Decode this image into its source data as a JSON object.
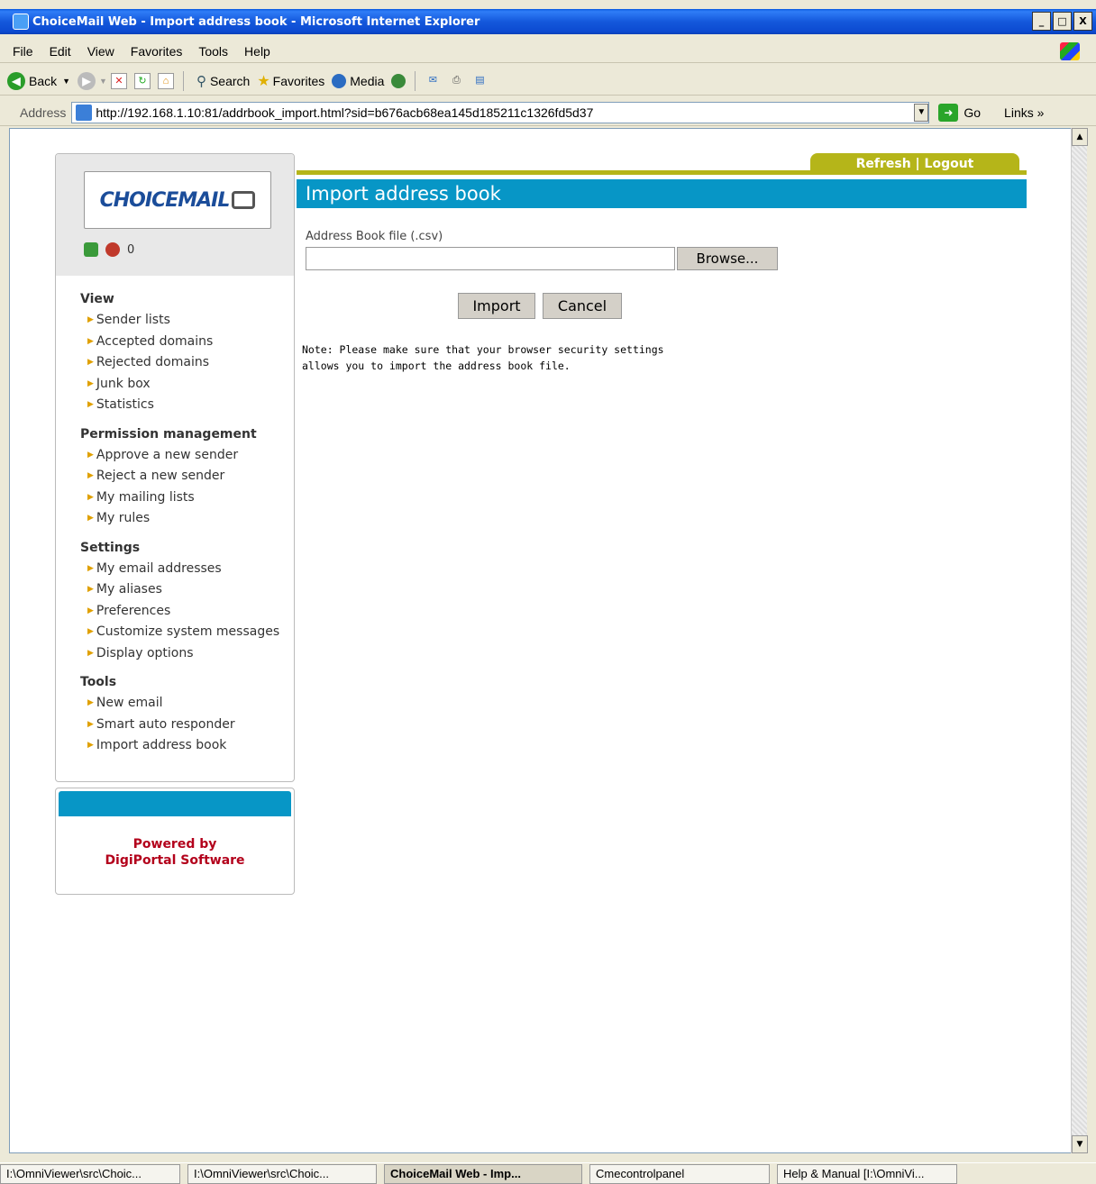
{
  "window": {
    "title": "ChoiceMail Web - Import address book - Microsoft Internet Explorer",
    "controls": [
      "_",
      "□",
      "X"
    ]
  },
  "menu": [
    "File",
    "Edit",
    "View",
    "Favorites",
    "Tools",
    "Help"
  ],
  "toolbar": {
    "back": "Back",
    "search": "Search",
    "favorites": "Favorites",
    "media": "Media"
  },
  "address": {
    "label": "Address",
    "url": "http://192.168.1.10:81/addrbook_import.html?sid=b676acb68ea145d185211c1326fd5d37",
    "go": "Go",
    "links": "Links"
  },
  "logo": {
    "text": "CHOICEMAIL",
    "count": "0"
  },
  "sidebar": {
    "groups": [
      {
        "heading": "View",
        "items": [
          "Sender lists",
          "Accepted domains",
          "Rejected domains",
          "Junk box",
          "Statistics"
        ]
      },
      {
        "heading": "Permission management",
        "items": [
          "Approve a new sender",
          "Reject a new sender",
          "My mailing lists",
          "My rules"
        ]
      },
      {
        "heading": "Settings",
        "items": [
          "My email addresses",
          "My aliases",
          "Preferences",
          "Customize system messages",
          "Display options"
        ]
      },
      {
        "heading": "Tools",
        "items": [
          "New email",
          "Smart auto responder",
          "Import address book"
        ]
      }
    ],
    "powered_line1": "Powered by",
    "powered_line2": "DigiPortal Software"
  },
  "header": {
    "links": "Refresh | Logout",
    "title": "Import address book"
  },
  "form": {
    "file_label": "Address Book file (.csv)",
    "file_value": "",
    "browse": "Browse...",
    "import": "Import",
    "cancel": "Cancel",
    "note_line1": "Note: Please make sure that your browser security settings",
    "note_line2": "allows you to import the address book file."
  },
  "taskbar": [
    "I:\\OmniViewer\\src\\Choic...",
    "I:\\OmniViewer\\src\\Choic...",
    "ChoiceMail Web - Imp...",
    "Cmecontrolpanel",
    "Help & Manual [I:\\OmniVi..."
  ],
  "colors": {
    "accent": "#0796c6",
    "olive": "#b5b519",
    "powered": "#b3001b"
  }
}
